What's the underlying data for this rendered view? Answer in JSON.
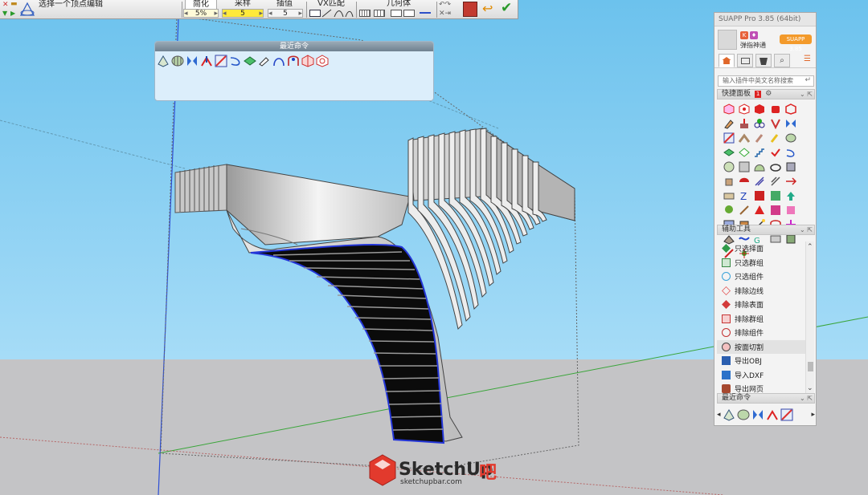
{
  "toolbar": {
    "left_label": "选择一个顶点编辑",
    "simplify": {
      "title": "简化",
      "value": "5%"
    },
    "sample": {
      "title": "采样",
      "value": "5"
    },
    "interp": {
      "title": "插值",
      "value": "5"
    },
    "vx_match": {
      "title": "VX匹配"
    },
    "geometry": {
      "title": "几何体"
    }
  },
  "recent_panel": {
    "title": "最近命令",
    "icons": [
      "bulge-icon",
      "shell-icon",
      "mirror-icon",
      "arrows-icon",
      "curve-panel-icon",
      "hook-icon",
      "face-icon",
      "pencil-icon",
      "arch-icon",
      "gate-icon",
      "cube-icon",
      "gem-icon"
    ]
  },
  "suapp": {
    "title": "SUAPP Pro 3.85 (64bit)",
    "username": "弹指神通",
    "version_button": "SUAPP 3.85",
    "search_placeholder": "输入插件中英文名称搜索",
    "quick_panel": {
      "label": "快捷面板",
      "badge": "1"
    },
    "aux_tools": {
      "label": "辅助工具",
      "items": [
        {
          "label": "只选择面",
          "color": "#2f9a48"
        },
        {
          "label": "只选群组",
          "color": "#3a8a45"
        },
        {
          "label": "只选组件",
          "color": "#3aa3d9"
        },
        {
          "label": "排除边线",
          "color": "#e14a4a"
        },
        {
          "label": "排除表面",
          "color": "#d33b3b"
        },
        {
          "label": "排除群组",
          "color": "#c73535"
        },
        {
          "label": "排除组件",
          "color": "#c33030"
        },
        {
          "label": "按面切割",
          "color": "#444444"
        },
        {
          "label": "导出OBJ",
          "color": "#2b5fb0"
        },
        {
          "label": "导入DXF",
          "color": "#2b72c9"
        },
        {
          "label": "导出网页",
          "color": "#a6482f"
        }
      ]
    },
    "recent_footer": {
      "label": "最近命令"
    }
  },
  "watermark": {
    "brand": "SketchUp",
    "suffix": "吧",
    "site": "sketchupbar.com"
  },
  "colors": {
    "sky": "#6fc5ee",
    "ground": "#c4c4c6",
    "accent": "#f39a2b",
    "tool_red": "#e0383a"
  }
}
